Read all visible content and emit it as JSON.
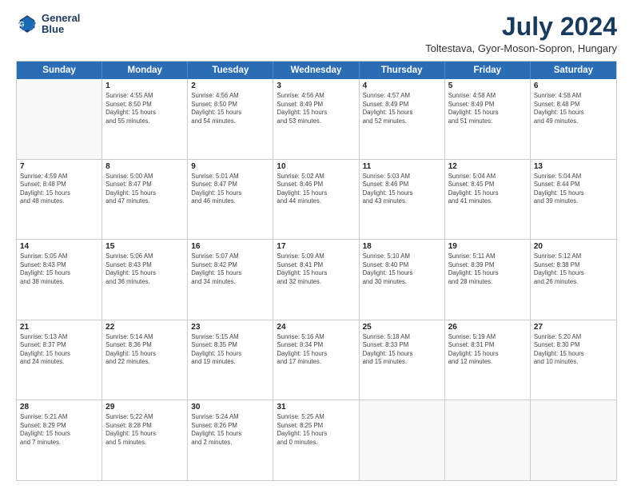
{
  "header": {
    "logo_line1": "General",
    "logo_line2": "Blue",
    "month_year": "July 2024",
    "location": "Toltestava, Gyor-Moson-Sopron, Hungary"
  },
  "weekdays": [
    "Sunday",
    "Monday",
    "Tuesday",
    "Wednesday",
    "Thursday",
    "Friday",
    "Saturday"
  ],
  "rows": [
    [
      {
        "day": "",
        "lines": []
      },
      {
        "day": "1",
        "lines": [
          "Sunrise: 4:55 AM",
          "Sunset: 8:50 PM",
          "Daylight: 15 hours",
          "and 55 minutes."
        ]
      },
      {
        "day": "2",
        "lines": [
          "Sunrise: 4:56 AM",
          "Sunset: 8:50 PM",
          "Daylight: 15 hours",
          "and 54 minutes."
        ]
      },
      {
        "day": "3",
        "lines": [
          "Sunrise: 4:56 AM",
          "Sunset: 8:49 PM",
          "Daylight: 15 hours",
          "and 53 minutes."
        ]
      },
      {
        "day": "4",
        "lines": [
          "Sunrise: 4:57 AM",
          "Sunset: 8:49 PM",
          "Daylight: 15 hours",
          "and 52 minutes."
        ]
      },
      {
        "day": "5",
        "lines": [
          "Sunrise: 4:58 AM",
          "Sunset: 8:49 PM",
          "Daylight: 15 hours",
          "and 51 minutes."
        ]
      },
      {
        "day": "6",
        "lines": [
          "Sunrise: 4:58 AM",
          "Sunset: 8:48 PM",
          "Daylight: 15 hours",
          "and 49 minutes."
        ]
      }
    ],
    [
      {
        "day": "7",
        "lines": [
          "Sunrise: 4:59 AM",
          "Sunset: 8:48 PM",
          "Daylight: 15 hours",
          "and 48 minutes."
        ]
      },
      {
        "day": "8",
        "lines": [
          "Sunrise: 5:00 AM",
          "Sunset: 8:47 PM",
          "Daylight: 15 hours",
          "and 47 minutes."
        ]
      },
      {
        "day": "9",
        "lines": [
          "Sunrise: 5:01 AM",
          "Sunset: 8:47 PM",
          "Daylight: 15 hours",
          "and 46 minutes."
        ]
      },
      {
        "day": "10",
        "lines": [
          "Sunrise: 5:02 AM",
          "Sunset: 8:46 PM",
          "Daylight: 15 hours",
          "and 44 minutes."
        ]
      },
      {
        "day": "11",
        "lines": [
          "Sunrise: 5:03 AM",
          "Sunset: 8:46 PM",
          "Daylight: 15 hours",
          "and 43 minutes."
        ]
      },
      {
        "day": "12",
        "lines": [
          "Sunrise: 5:04 AM",
          "Sunset: 8:45 PM",
          "Daylight: 15 hours",
          "and 41 minutes."
        ]
      },
      {
        "day": "13",
        "lines": [
          "Sunrise: 5:04 AM",
          "Sunset: 8:44 PM",
          "Daylight: 15 hours",
          "and 39 minutes."
        ]
      }
    ],
    [
      {
        "day": "14",
        "lines": [
          "Sunrise: 5:05 AM",
          "Sunset: 8:43 PM",
          "Daylight: 15 hours",
          "and 38 minutes."
        ]
      },
      {
        "day": "15",
        "lines": [
          "Sunrise: 5:06 AM",
          "Sunset: 8:43 PM",
          "Daylight: 15 hours",
          "and 36 minutes."
        ]
      },
      {
        "day": "16",
        "lines": [
          "Sunrise: 5:07 AM",
          "Sunset: 8:42 PM",
          "Daylight: 15 hours",
          "and 34 minutes."
        ]
      },
      {
        "day": "17",
        "lines": [
          "Sunrise: 5:09 AM",
          "Sunset: 8:41 PM",
          "Daylight: 15 hours",
          "and 32 minutes."
        ]
      },
      {
        "day": "18",
        "lines": [
          "Sunrise: 5:10 AM",
          "Sunset: 8:40 PM",
          "Daylight: 15 hours",
          "and 30 minutes."
        ]
      },
      {
        "day": "19",
        "lines": [
          "Sunrise: 5:11 AM",
          "Sunset: 8:39 PM",
          "Daylight: 15 hours",
          "and 28 minutes."
        ]
      },
      {
        "day": "20",
        "lines": [
          "Sunrise: 5:12 AM",
          "Sunset: 8:38 PM",
          "Daylight: 15 hours",
          "and 26 minutes."
        ]
      }
    ],
    [
      {
        "day": "21",
        "lines": [
          "Sunrise: 5:13 AM",
          "Sunset: 8:37 PM",
          "Daylight: 15 hours",
          "and 24 minutes."
        ]
      },
      {
        "day": "22",
        "lines": [
          "Sunrise: 5:14 AM",
          "Sunset: 8:36 PM",
          "Daylight: 15 hours",
          "and 22 minutes."
        ]
      },
      {
        "day": "23",
        "lines": [
          "Sunrise: 5:15 AM",
          "Sunset: 8:35 PM",
          "Daylight: 15 hours",
          "and 19 minutes."
        ]
      },
      {
        "day": "24",
        "lines": [
          "Sunrise: 5:16 AM",
          "Sunset: 8:34 PM",
          "Daylight: 15 hours",
          "and 17 minutes."
        ]
      },
      {
        "day": "25",
        "lines": [
          "Sunrise: 5:18 AM",
          "Sunset: 8:33 PM",
          "Daylight: 15 hours",
          "and 15 minutes."
        ]
      },
      {
        "day": "26",
        "lines": [
          "Sunrise: 5:19 AM",
          "Sunset: 8:31 PM",
          "Daylight: 15 hours",
          "and 12 minutes."
        ]
      },
      {
        "day": "27",
        "lines": [
          "Sunrise: 5:20 AM",
          "Sunset: 8:30 PM",
          "Daylight: 15 hours",
          "and 10 minutes."
        ]
      }
    ],
    [
      {
        "day": "28",
        "lines": [
          "Sunrise: 5:21 AM",
          "Sunset: 8:29 PM",
          "Daylight: 15 hours",
          "and 7 minutes."
        ]
      },
      {
        "day": "29",
        "lines": [
          "Sunrise: 5:22 AM",
          "Sunset: 8:28 PM",
          "Daylight: 15 hours",
          "and 5 minutes."
        ]
      },
      {
        "day": "30",
        "lines": [
          "Sunrise: 5:24 AM",
          "Sunset: 8:26 PM",
          "Daylight: 15 hours",
          "and 2 minutes."
        ]
      },
      {
        "day": "31",
        "lines": [
          "Sunrise: 5:25 AM",
          "Sunset: 8:25 PM",
          "Daylight: 15 hours",
          "and 0 minutes."
        ]
      },
      {
        "day": "",
        "lines": []
      },
      {
        "day": "",
        "lines": []
      },
      {
        "day": "",
        "lines": []
      }
    ]
  ]
}
